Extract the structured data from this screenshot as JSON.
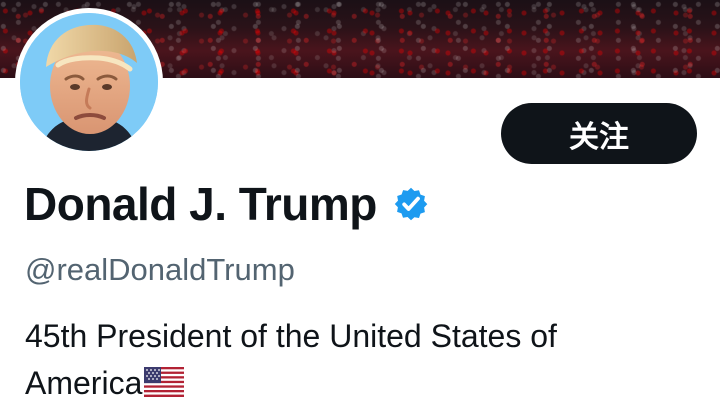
{
  "profile": {
    "display_name": "Donald J. Trump",
    "handle": "@realDonaldTrump",
    "follow_button_label": "关注",
    "bio_line_1": "45th President of the United States of",
    "bio_line_2": "America",
    "verified": true,
    "colors": {
      "text_primary": "#0f1419",
      "text_secondary": "#536471",
      "button_background": "#0f1419",
      "verified_blue": "#1d9bf0"
    },
    "icons": {
      "verified": "verified-badge-icon",
      "flag": "us-flag-icon"
    }
  }
}
